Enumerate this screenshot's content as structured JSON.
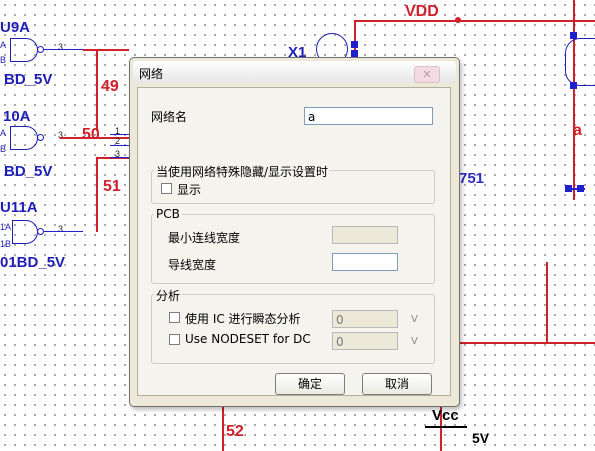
{
  "schematic": {
    "net_vdd": "VDD",
    "net_49": "49",
    "net_50": "50",
    "net_51": "51",
    "net_52": "52",
    "net_a": "a",
    "net_751": "751",
    "net_5v": "5V",
    "vcc_label": "Vcc",
    "comp_u9a": "U9A",
    "comp_u9a_model": "BD_5V",
    "comp_u10a": "10A",
    "comp_u10a_model": "BD_5V",
    "comp_u11a": "U11A",
    "comp_u11a_model": "01BD_5V",
    "comp_x1": "X1",
    "pin_a": "A",
    "pin_b": "B",
    "pin_1a": "1A",
    "pin_1b": "1B",
    "pin_3": "3",
    "pin_1": "1",
    "pin_2": "2"
  },
  "dialog": {
    "title": "网络",
    "close_glyph": "✕",
    "net_name_label": "网络名",
    "net_name_value": "a",
    "special_group_title": "当使用网络特殊隐藏/显示设置时",
    "show_checkbox_label": "显示",
    "pcb_group_title": "PCB",
    "min_width_label": "最小连线宽度",
    "min_width_value": "",
    "trace_width_label": "导线宽度",
    "trace_width_value": "",
    "analysis_group_title": "分析",
    "ic_checkbox_label": "使用 IC 进行瞬态分析",
    "ic_value": "0",
    "ic_unit": "V",
    "nodeset_checkbox_label": "Use NODESET for DC",
    "nodeset_value": "0",
    "nodeset_unit": "V",
    "ok_button": "确定",
    "cancel_button": "取消"
  }
}
